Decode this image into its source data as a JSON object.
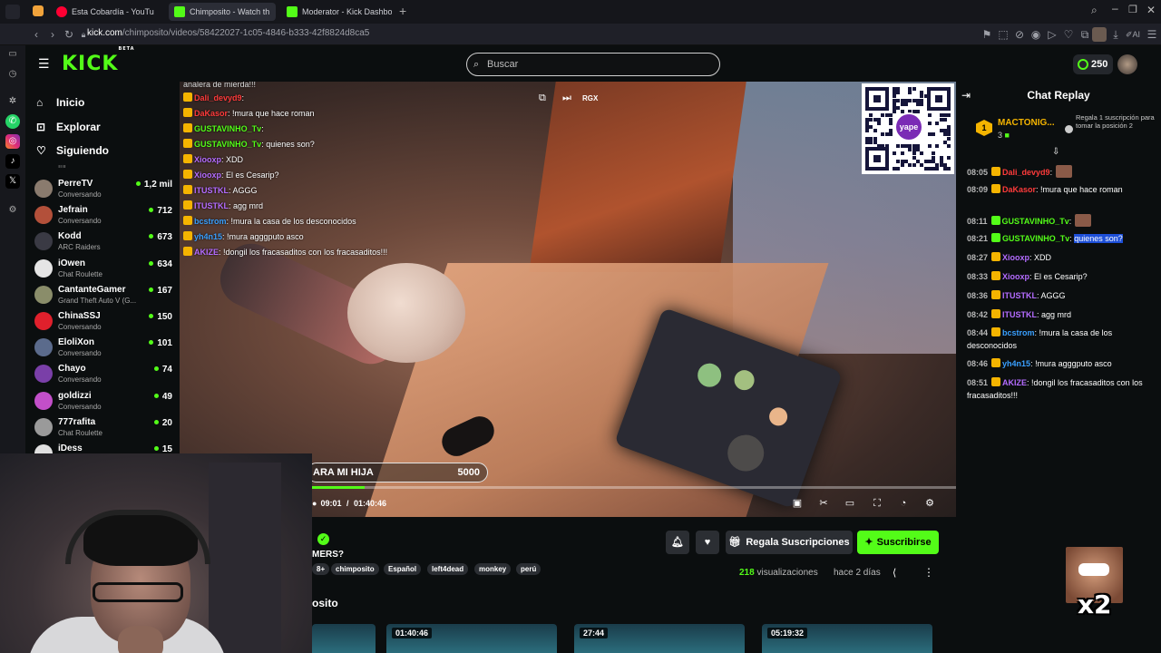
{
  "browser": {
    "tabs": [
      {
        "label": "Esta Cobardía - YouTu",
        "favicon": "youtube-icon",
        "color": "#ff0033"
      },
      {
        "label": "Chimposito - Watch th",
        "favicon": "kick-icon",
        "color": "#53fc18"
      },
      {
        "label": "Moderator - Kick Dashboa",
        "favicon": "kick-icon",
        "color": "#53fc18"
      }
    ],
    "url_host": "kick.com",
    "url_path": "/chimposito/videos/58422027-1c05-4846-b333-42f8824d8ca5"
  },
  "header": {
    "logo": "KICK",
    "logo_beta": "BETA",
    "search_placeholder": "Buscar",
    "kicks_balance": "250"
  },
  "nav": {
    "links": [
      {
        "label": "Inicio",
        "icon": "home-icon"
      },
      {
        "label": "Explorar",
        "icon": "compass-icon"
      },
      {
        "label": "Siguiendo",
        "icon": "heart-icon"
      }
    ],
    "clipped_category": "Ini",
    "channels": [
      {
        "name": "PerreTV",
        "category": "Conversando",
        "viewers": "1,2 mil",
        "color": "#8a7b6e"
      },
      {
        "name": "Jefrain",
        "category": "Conversando",
        "viewers": "712",
        "color": "#b3503a"
      },
      {
        "name": "Kodd",
        "category": "ARC Raiders",
        "viewers": "673",
        "color": "#3a3a44"
      },
      {
        "name": "iOwen",
        "category": "Chat Roulette",
        "viewers": "634",
        "color": "#e5e5e5"
      },
      {
        "name": "CantanteGamer",
        "category": "Grand Theft Auto V (G...",
        "viewers": "167",
        "color": "#8a8d6a"
      },
      {
        "name": "ChinaSSJ",
        "category": "Conversando",
        "viewers": "150",
        "color": "#e0202c"
      },
      {
        "name": "EloliXon",
        "category": "Conversando",
        "viewers": "101",
        "color": "#5b6b8c"
      },
      {
        "name": "Chayo",
        "category": "Conversando",
        "viewers": "74",
        "color": "#7a3fa8"
      },
      {
        "name": "goldizzi",
        "category": "Conversando",
        "viewers": "49",
        "color": "#c24fc9"
      },
      {
        "name": "777rafita",
        "category": "Chat Roulette",
        "viewers": "20",
        "color": "#9a9a9a"
      },
      {
        "name": "iDess",
        "category": "",
        "viewers": "15",
        "color": "#e0e0e0"
      }
    ]
  },
  "video_overlay": {
    "top_line": "analera de mierda!!!",
    "chat": [
      {
        "user": "Dali_devyd9",
        "msg": ":",
        "color": "#ff3b3b"
      },
      {
        "user": "DaKasor",
        "msg": ": !mura que hace roman",
        "color": "#ff3b3b"
      },
      {
        "user": "GUSTAVINHO_Tv",
        "msg": ":",
        "color": "#53fc18"
      },
      {
        "user": "GUSTAVINHO_Tv",
        "msg": ": quienes son?",
        "color": "#53fc18"
      },
      {
        "user": "Xiooxp",
        "msg": ": XDD",
        "color": "#b46cff"
      },
      {
        "user": "Xiooxp",
        "msg": ": El es Cesarip?",
        "color": "#b46cff"
      },
      {
        "user": "ITUSTKL",
        "msg": ": AGGG",
        "color": "#b46cff"
      },
      {
        "user": "ITUSTKL",
        "msg": ": agg mrd",
        "color": "#b46cff"
      },
      {
        "user": "bcstrom",
        "msg": ": !mura la casa de los desconocidos",
        "color": "#3aa0ff"
      },
      {
        "user": "yh4n15",
        "msg": ": !mura agggputo asco",
        "color": "#3aa0ff"
      },
      {
        "user": "AKIZE",
        "msg": ": !dongil los fracasaditos con los fracasaditos!!!",
        "color": "#b46cff"
      }
    ],
    "qr_label": "yape",
    "top_controls_label": "RGX",
    "goal_text": "ARA MI HIJA",
    "goal_amount": "5000",
    "time_current": "09:01",
    "time_separator": "/",
    "time_total": "01:40:46",
    "progress_fraction": 0.09
  },
  "below_video": {
    "title_fragment": "MERS?",
    "tags": [
      "8+",
      "chimposito",
      "Español",
      "left4dead",
      "monkey",
      "perú"
    ],
    "gift_button": "Regala Suscripciones",
    "subscribe_button": "Suscribirse",
    "views_count": "218",
    "views_label": "visualizaciones",
    "time_ago": "hace 2 días",
    "section_title_fragment": "osito",
    "thumbnail_durations": [
      "",
      "01:40:46",
      "27:44",
      "05:19:32"
    ]
  },
  "chat": {
    "title": "Chat Replay",
    "pinned_user": "MACTONIG...",
    "pinned_count": "3",
    "pinned_text": "Regala 1 suscripción para tomar la posición 2",
    "messages": [
      {
        "time": "08:05",
        "user": "Dali_devyd9",
        "text": ":",
        "color": "#ff3b3b"
      },
      {
        "time": "08:09",
        "user": "DaKasor",
        "text": ": !mura que hace roman",
        "color": "#ff3b3b"
      },
      {
        "time": "08:11",
        "user": "GUSTAVINHO_Tv",
        "text": ":",
        "color": "#53fc18"
      },
      {
        "time": "08:21",
        "user": "GUSTAVINHO_Tv",
        "text": ": ",
        "highlight": "quienes son?",
        "color": "#53fc18"
      },
      {
        "time": "08:27",
        "user": "Xiooxp",
        "text": ": XDD",
        "color": "#b46cff"
      },
      {
        "time": "08:33",
        "user": "Xiooxp",
        "text": ": El es Cesarip?",
        "color": "#b46cff"
      },
      {
        "time": "08:36",
        "user": "ITUSTKL",
        "text": ": AGGG",
        "color": "#b46cff"
      },
      {
        "time": "08:42",
        "user": "ITUSTKL",
        "text": ": agg mrd",
        "color": "#b46cff"
      },
      {
        "time": "08:44",
        "user": "bcstrom",
        "text": ": !mura la casa de los desconocidos",
        "color": "#3aa0ff"
      },
      {
        "time": "08:46",
        "user": "yh4n15",
        "text": ": !mura agggputo asco",
        "color": "#3aa0ff"
      },
      {
        "time": "08:51",
        "user": "AKIZE",
        "text": ": !dongil los fracasaditos con los fracasaditos!!!",
        "color": "#b46cff"
      }
    ],
    "overlay_multiplier": "x2"
  }
}
